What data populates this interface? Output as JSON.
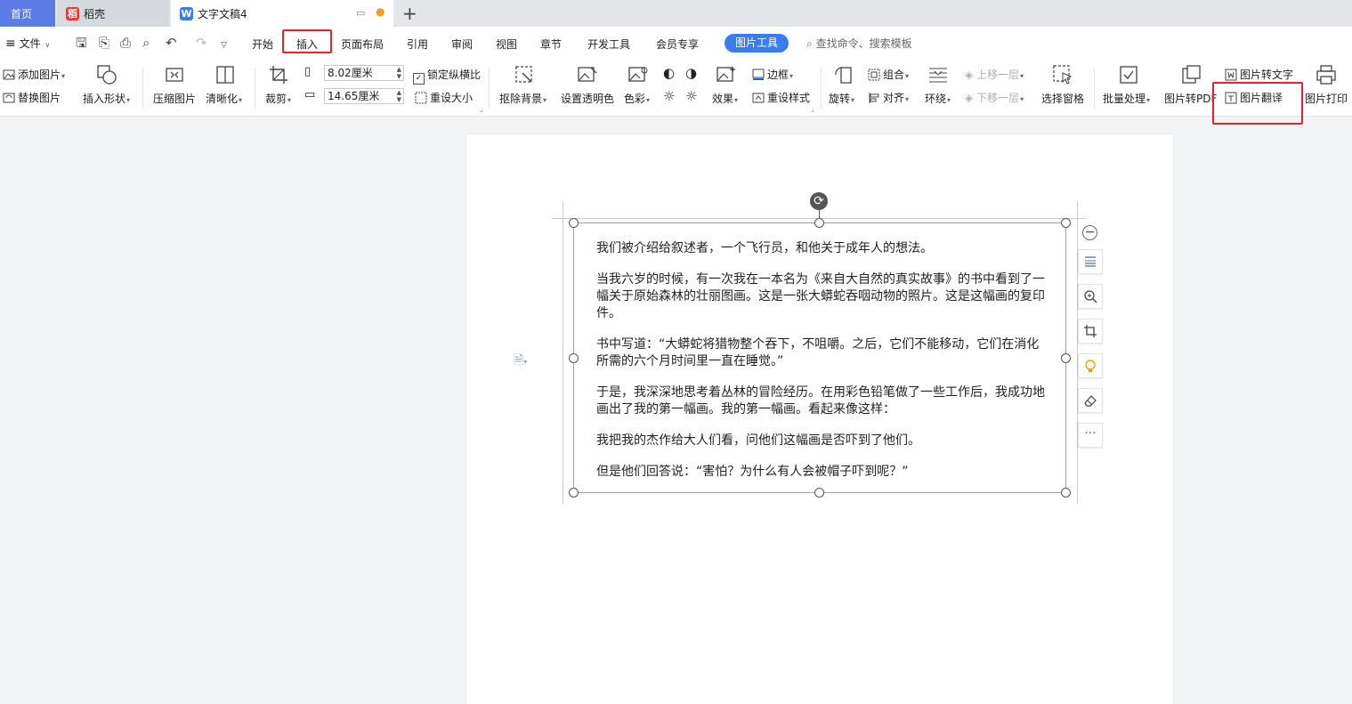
{
  "tabs": {
    "home": "首页",
    "daoke": "稻壳",
    "doc": "文字文稿4",
    "add": "+"
  },
  "menu": {
    "file": "文件",
    "items": [
      "开始",
      "插入",
      "页面布局",
      "引用",
      "审阅",
      "视图",
      "章节",
      "开发工具",
      "会员专享"
    ],
    "picture_tools": "图片工具",
    "search": "查找命令、搜索模板"
  },
  "ribbon": {
    "add_picture": "添加图片",
    "replace_picture": "替换图片",
    "insert_shape": "插入形状",
    "compress_picture": "压缩图片",
    "sharpen": "清晰化",
    "crop": "裁剪",
    "width_value": "8.02厘米",
    "height_value": "14.65厘米",
    "lock_ratio": "锁定纵横比",
    "reset_size": "重设大小",
    "remove_bg": "抠除背景",
    "set_transparent": "设置透明色",
    "color": "色彩",
    "effects": "效果",
    "border": "边框",
    "reset_style": "重设样式",
    "rotate": "旋转",
    "group": "组合",
    "align": "对齐",
    "wrap": "环绕",
    "bring_forward": "上移一层",
    "send_backward": "下移一层",
    "select_pane": "选择窗格",
    "batch": "批量处理",
    "to_pdf": "图片转PDF",
    "to_text": "图片转文字",
    "translate": "图片翻译",
    "print": "图片打印"
  },
  "document": {
    "paragraphs": [
      "我们被介绍给叙述者，一个飞行员，和他关于成年人的想法。",
      "当我六岁的时候，有一次我在一本名为《来自大自然的真实故事》的书中看到了一幅关于原始森林的壮丽图画。这是一张大蟒蛇吞咽动物的照片。这是这幅画的复印件。",
      "书中写道：“大蟒蛇将猎物整个吞下，不咀嚼。之后，它们不能移动，它们在消化所需的六个月时间里一直在睡觉。”",
      "于是，我深深地思考着丛林的冒险经历。在用彩色铅笔做了一些工作后，我成功地画出了我的第一幅画。我的第一幅画。看起来像这样：",
      "我把我的杰作给大人们看，问他们这幅画是否吓到了他们。",
      "但是他们回答说：“害怕？为什么有人会被帽子吓到呢？”"
    ]
  },
  "colors": {
    "accent": "#3b7cf0",
    "highlight_box": "#e3242b",
    "home_tab": "#5b7ce6"
  }
}
